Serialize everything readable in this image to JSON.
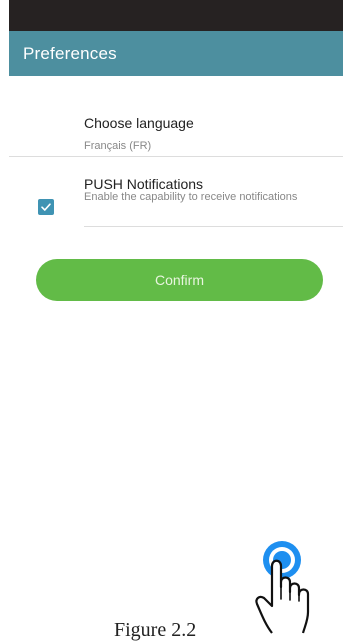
{
  "app": {
    "title": "Preferences"
  },
  "language_setting": {
    "title": "Choose language",
    "value": "Français (FR)"
  },
  "push_setting": {
    "title": "PUSH Notifications",
    "description": "Enable the capability to receive notifications",
    "checked": true
  },
  "actions": {
    "confirm_label": "Confirm"
  },
  "caption": {
    "text": "Figure 2.2"
  },
  "icons": {
    "checkbox": "check-icon",
    "gesture": "tap-hand-icon"
  },
  "colors": {
    "status_bar": "#262222",
    "app_bar": "#4d8f9f",
    "checkbox": "#3f93b3",
    "confirm": "#62bb47",
    "tap_ring": "#1e8ff0"
  }
}
